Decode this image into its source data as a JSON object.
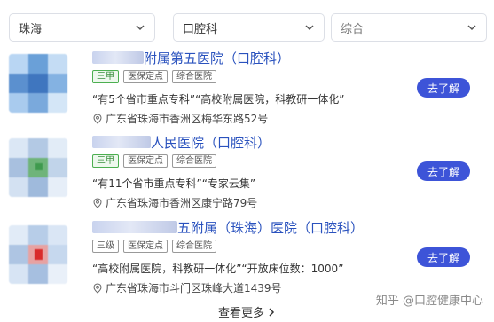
{
  "filters": [
    {
      "label": "珠海"
    },
    {
      "label": "口腔科"
    },
    {
      "label": "综合"
    }
  ],
  "hospitals": [
    {
      "title_visible": "附属第五医院（口腔科）",
      "tags": [
        "三甲",
        "医保定点",
        "综合医院"
      ],
      "desc": "“有5个省市重点专科”“高校附属医院，科教研一体化”",
      "address": "广东省珠海市香洲区梅华东路52号",
      "button": "去了解"
    },
    {
      "title_visible": "人民医院（口腔科）",
      "tags": [
        "三甲",
        "医保定点",
        "综合医院"
      ],
      "desc": "“有11个省市重点专科”“专家云集”",
      "address": "广东省珠海市香洲区康宁路79号",
      "button": "去了解"
    },
    {
      "title_visible": "五附属（珠海）医院（口腔科）",
      "tags": [
        "三级",
        "医保定点",
        "综合医院"
      ],
      "desc": "“高校附属医院，科教研一体化”“开放床位数：1000”",
      "address": "广东省珠海市斗门区珠峰大道1439号",
      "button": "去了解"
    }
  ],
  "more": {
    "label": "查看更多"
  },
  "watermark": {
    "text": "知乎 @口腔健康中心"
  },
  "colors": {
    "accent": "#3d54d8",
    "title": "#2a52be",
    "tag_green": "#4caf50"
  }
}
